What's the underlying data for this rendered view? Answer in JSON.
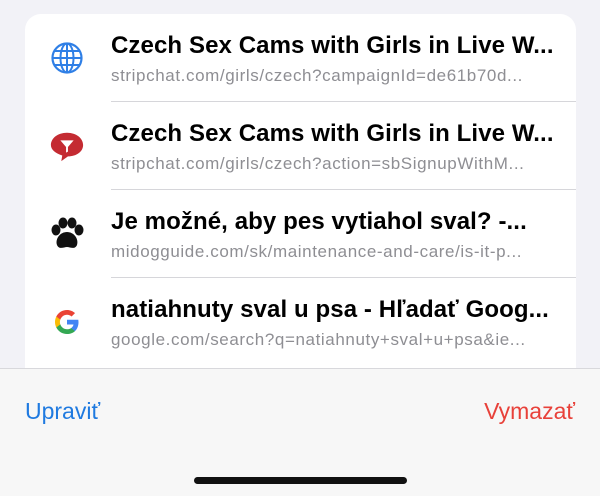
{
  "history": [
    {
      "title": "Czech Sex Cams with Girls in Live W...",
      "url": "stripchat.com/girls/czech?campaignId=de61b70d...",
      "icon": "globe-icon"
    },
    {
      "title": "Czech Sex Cams with Girls in Live W...",
      "url": "stripchat.com/girls/czech?action=sbSignupWithM...",
      "icon": "stripchat-speech-bubble-icon"
    },
    {
      "title": "Je možné, aby pes vytiahol sval? -...",
      "url": "midogguide.com/sk/maintenance-and-care/is-it-p...",
      "icon": "paw-print-icon"
    },
    {
      "title": "natiahnuty sval u psa - Hľadať Goog...",
      "url": "google.com/search?q=natiahnuty+sval+u+psa&ie...",
      "icon": "google-g-icon"
    }
  ],
  "toolbar": {
    "edit_label": "Upraviť",
    "clear_label": "Vymazať"
  },
  "colors": {
    "accent_blue": "#1f7ae0",
    "destructive_red": "#e8413a",
    "secondary_text": "#8e8e93"
  }
}
